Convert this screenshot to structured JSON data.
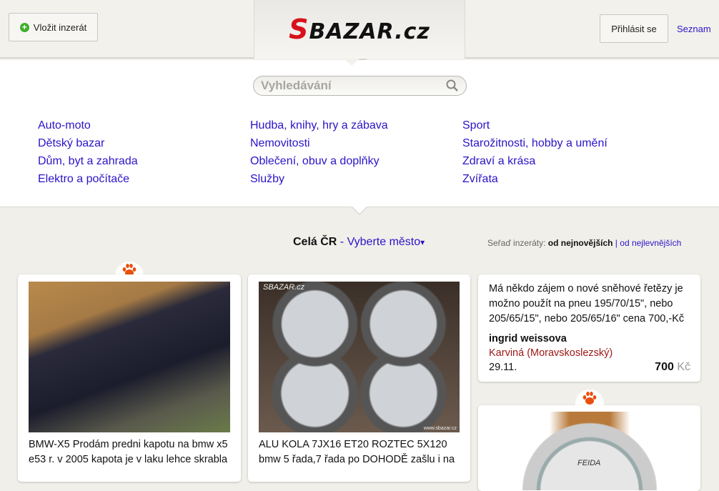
{
  "header": {
    "add_button": "Vložit inzerát",
    "logo": "SBAZAR.cz",
    "login_button": "Přihlásit se",
    "seznam_link": "Seznam"
  },
  "search": {
    "placeholder": "Vyhledávání"
  },
  "categories": [
    [
      "Auto-moto",
      "Dětský bazar",
      "Dům, byt a zahrada",
      "Elektro a počítače"
    ],
    [
      "Hudba, knihy, hry a zábava",
      "Nemovitosti",
      "Oblečení, obuv a doplňky",
      "Služby"
    ],
    [
      "Sport",
      "Starožitnosti, hobby a umění",
      "Zdraví a krása",
      "Zvířata"
    ]
  ],
  "location": {
    "current": "Celá ČR",
    "separator": " - ",
    "choose": "Vyberte město",
    "arrow": "▾"
  },
  "sort": {
    "label": "Seřaď inzeráty:",
    "newest": "od nejnovějších",
    "sep": "|",
    "cheapest": "od nejlevnějších"
  },
  "listings": [
    {
      "title": "BMW-X5 Prodám predni kapotu na bmw x5 e53 r. v 2005 kapota je v laku lehce skrabla"
    },
    {
      "title": "ALU KOLA 7JX16 ET20 ROZTEC 5X120 bmw 5 řada,7 řada po DOHODĚ zašlu i na",
      "watermark": "SBAZAR.cz",
      "watermark2": "www.sbazar.cz"
    },
    {
      "title": "Má někdo zájem o nové sněhové řetězy je možno použít na pneu 195/70/15\", nebo 205/65/15\", nebo 205/65/16\" cena 700,-Kč",
      "seller": "ingrid weissova",
      "place": "Karviná (Moravskoslezský)",
      "date": "29.11.",
      "price": "700",
      "currency": "Kč"
    },
    {
      "brand": "FEIDA"
    }
  ],
  "colors": {
    "link": "#2a14c8",
    "logo_red": "#d8121b",
    "paw": "#e8500e",
    "place": "#a01818"
  }
}
